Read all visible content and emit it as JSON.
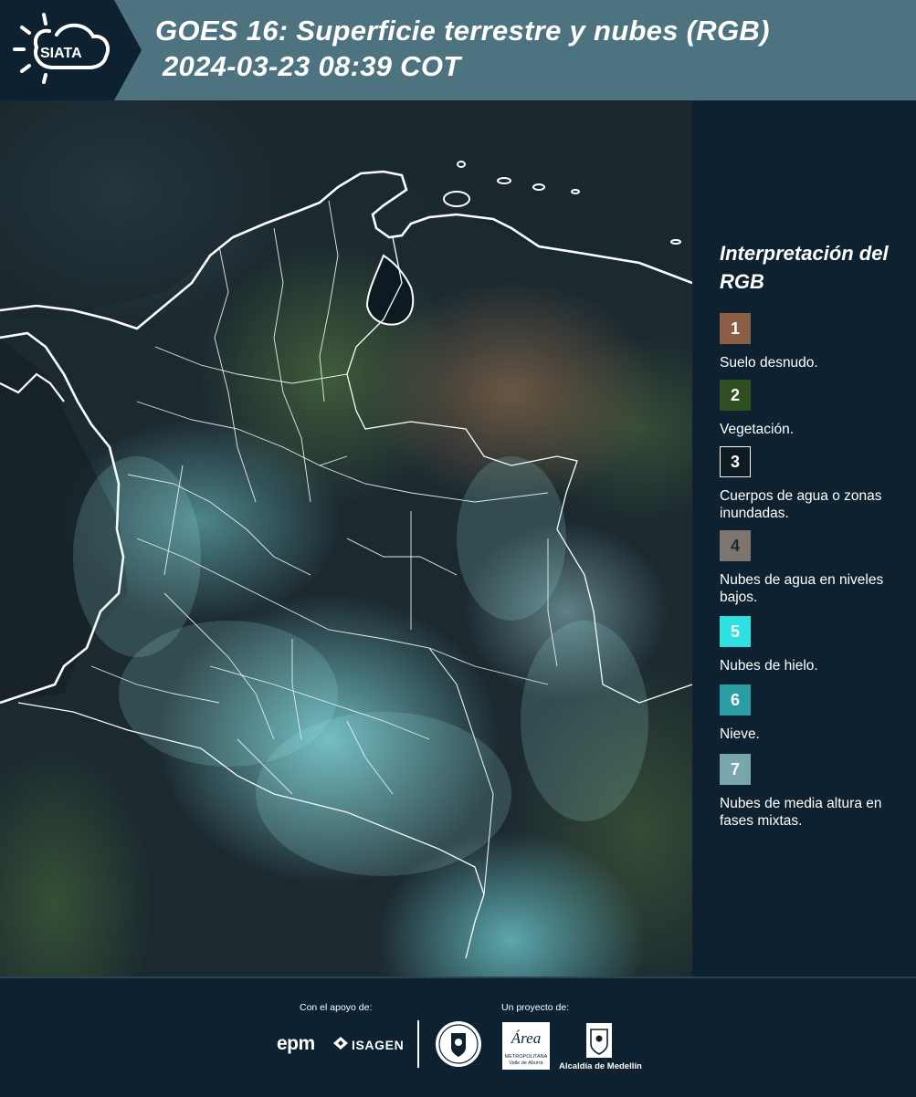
{
  "header": {
    "brand": "SIATA",
    "title_line1": "GOES 16: Superficie terrestre y nubes (RGB)",
    "title_line2": "2024-03-23 08:39 COT"
  },
  "map": {
    "border_color": "#ffffff",
    "icon": "satellite-rgb-image"
  },
  "legend": {
    "title": "Interpretación del RGB",
    "items": [
      {
        "number": "1",
        "label": "Suelo desnudo.",
        "color": "#8a5e45"
      },
      {
        "number": "2",
        "label": "Vegetación.",
        "color": "#2f4f22"
      },
      {
        "number": "3",
        "label": "Cuerpos de agua o zonas inundadas.",
        "color": "#0d1a22"
      },
      {
        "number": "4",
        "label": "Nubes de agua en niveles bajos.",
        "color": "#7d7670"
      },
      {
        "number": "5",
        "label": "Nubes de hielo.",
        "color": "#2fe0e0"
      },
      {
        "number": "6",
        "label": "Nieve.",
        "color": "#2a9da2"
      },
      {
        "number": "7",
        "label": "Nubes de media altura en fases mixtas.",
        "color": "#79a6aa"
      }
    ]
  },
  "footer": {
    "support_caption": "Con el apoyo de:",
    "project_caption": "Un proyecto de:",
    "epm": "epm",
    "isagen": "ISAGEN",
    "area_logo": "Área",
    "area_sub": "METROPOLITANA Valle de Aburrá",
    "alcaldia": "Alcaldía de Medellín"
  }
}
